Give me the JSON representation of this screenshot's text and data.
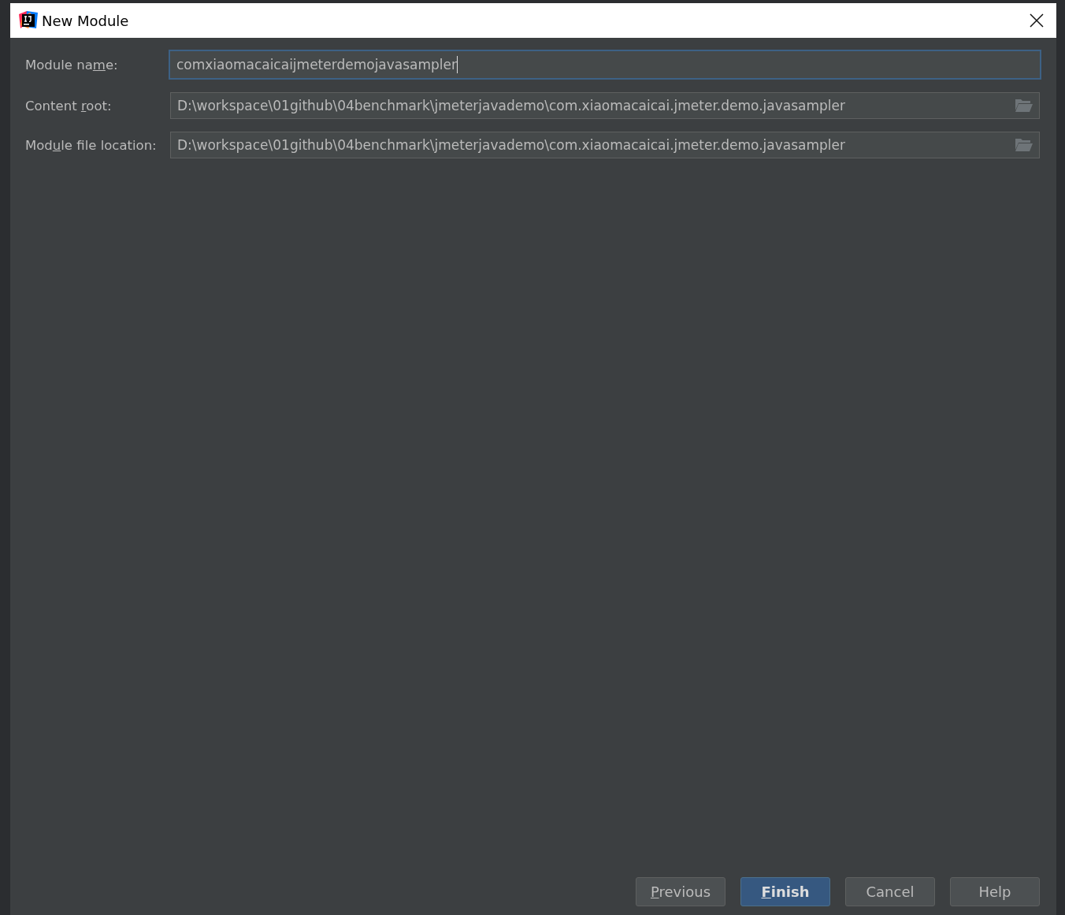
{
  "window": {
    "title": "New Module"
  },
  "fields": [
    {
      "label": {
        "start": "Module na",
        "mnemonic": "m",
        "end": "e:"
      },
      "value": "comxiaomacaicaijmeterdemojavasampler",
      "focused": true,
      "browse": false
    },
    {
      "label": {
        "start": "Content ",
        "mnemonic": "r",
        "end": "oot:"
      },
      "value": "D:\\workspace\\01github\\04benchmark\\jmeterjavademo\\com.xiaomacaicai.jmeter.demo.javasampler",
      "focused": false,
      "browse": true
    },
    {
      "label": {
        "start": "Mod",
        "mnemonic": "u",
        "end": "le file location:"
      },
      "value": "D:\\workspace\\01github\\04benchmark\\jmeterjavademo\\com.xiaomacaicai.jmeter.demo.javasampler",
      "focused": false,
      "browse": true
    }
  ],
  "buttons": [
    {
      "label": {
        "mnemonic": "P",
        "end": "revious"
      },
      "default": false
    },
    {
      "label": {
        "mnemonic": "F",
        "end": "inish"
      },
      "default": true
    },
    {
      "label": {
        "start": "Cancel"
      },
      "default": false
    },
    {
      "label": {
        "start": "Help"
      },
      "default": false
    }
  ]
}
